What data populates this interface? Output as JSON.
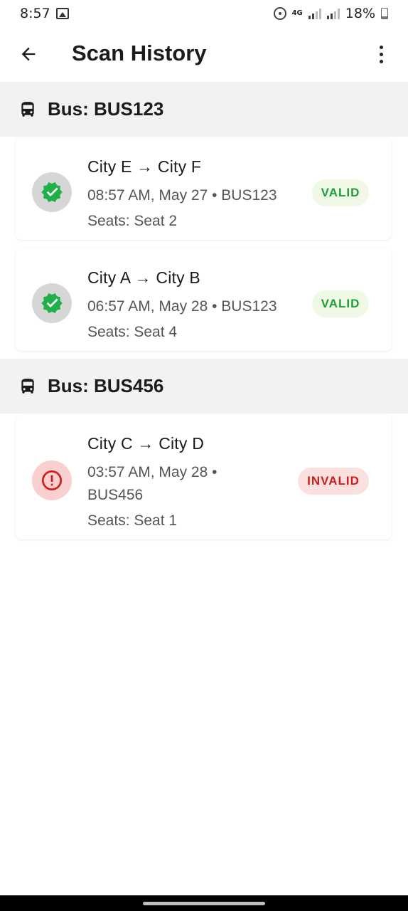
{
  "status_bar": {
    "time": "8:57",
    "network": "4G",
    "battery": "18%"
  },
  "app_bar": {
    "title": "Scan History",
    "back_icon": "arrow-left-icon",
    "more_icon": "more-vert-icon"
  },
  "colors": {
    "valid_text": "#1d9e3a",
    "valid_bg": "#f0f8e6",
    "invalid_text": "#d11a1a",
    "invalid_bg": "#fbe0e0",
    "header_bg": "#f2f2f2"
  },
  "groups": [
    {
      "title": "Bus: BUS123",
      "icon": "bus-icon",
      "scans": [
        {
          "route": "City E → City F",
          "meta": "08:57 AM, May 27 • BUS123",
          "seats": "Seats: Seat 2",
          "status": "VALID",
          "icon": "verified-check-icon"
        },
        {
          "route": "City A → City B",
          "meta": "06:57 AM, May 28 • BUS123",
          "seats": "Seats: Seat 4",
          "status": "VALID",
          "icon": "verified-check-icon"
        }
      ]
    },
    {
      "title": "Bus: BUS456",
      "icon": "bus-icon",
      "scans": [
        {
          "route": "City C → City D",
          "meta": "03:57 AM, May 28 • BUS456",
          "seats": "Seats: Seat 1",
          "status": "INVALID",
          "icon": "alert-circle-icon"
        }
      ]
    }
  ]
}
